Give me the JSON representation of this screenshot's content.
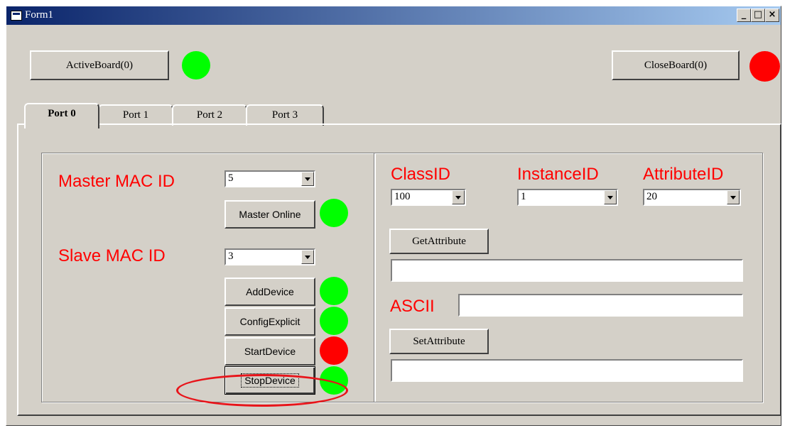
{
  "window": {
    "title": "Form1",
    "minimize": "_",
    "maximize": "□",
    "close": "×"
  },
  "top": {
    "active_board_label": "ActiveBoard(0)",
    "close_board_label": "CloseBoard(0)",
    "active_led": "#00ff00",
    "close_led": "#ff0000"
  },
  "tabs": [
    "Port 0",
    "Port 1",
    "Port 2",
    "Port 3"
  ],
  "left": {
    "master_label": "Master MAC ID",
    "master_value": "5",
    "master_online_label": "Master Online",
    "slave_label": "Slave MAC ID",
    "slave_value": "3",
    "add_device_label": "AddDevice",
    "config_explicit_label": "ConfigExplicit",
    "start_device_label": "StartDevice",
    "stop_device_label": "StopDevice"
  },
  "right": {
    "class_label": "ClassID",
    "class_value": "100",
    "instance_label": "InstanceID",
    "instance_value": "1",
    "attribute_label": "AttributeID",
    "attribute_value": "20",
    "get_attribute_label": "GetAttribute",
    "get_result": "",
    "ascii_label": "ASCII",
    "ascii_value": "",
    "set_attribute_label": "SetAttribute",
    "set_value": ""
  },
  "colors": {
    "green": "#00ff00",
    "red": "#ff0000",
    "highlight": "#e8141a"
  }
}
